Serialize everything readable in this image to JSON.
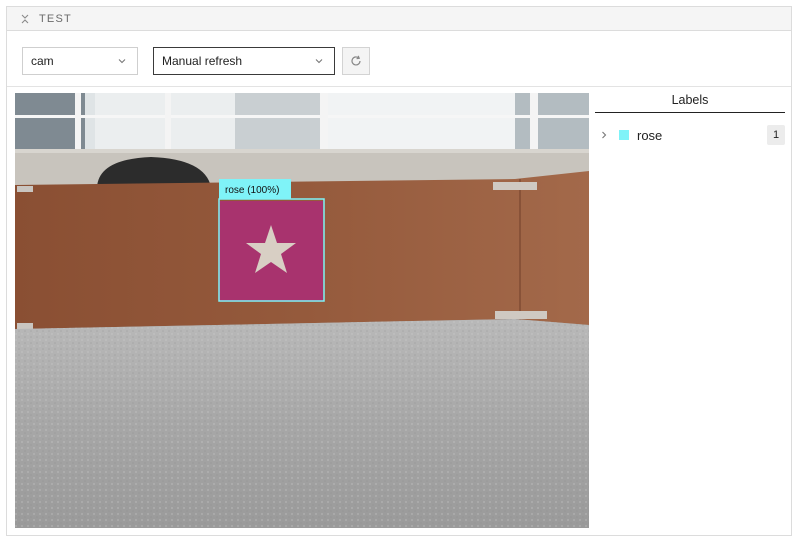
{
  "panel": {
    "title": "TEST"
  },
  "toolbar": {
    "camera_select": {
      "value": "cam"
    },
    "refresh_select": {
      "value": "Manual refresh"
    }
  },
  "camera_view": {
    "detections": [
      {
        "label_text": "rose (100%)",
        "color": "#7ff3f8"
      }
    ]
  },
  "labels": {
    "title": "Labels",
    "items": [
      {
        "name": "rose",
        "count": "1",
        "color": "#7ff3f8"
      }
    ]
  },
  "icons": {
    "collapse": "collapse-icon",
    "chevron": "chevron-down-icon",
    "refresh": "refresh-icon",
    "expand": "chevron-right-icon"
  }
}
